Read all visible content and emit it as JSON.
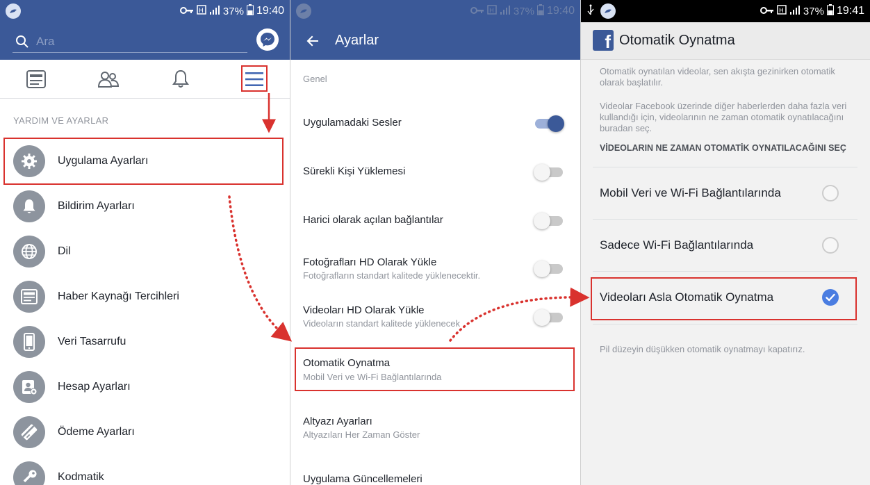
{
  "status_left": {
    "signal": "37%",
    "time": "19:40"
  },
  "status_mid": {
    "signal": "37%",
    "time": "19:40"
  },
  "status_right": {
    "signal": "37%",
    "time": "19:41"
  },
  "panel1": {
    "search": {
      "placeholder": "Ara"
    },
    "section_label": "YARDIM VE AYARLAR",
    "items": [
      {
        "label": "Uygulama Ayarları",
        "icon": "gear-icon"
      },
      {
        "label": "Bildirim Ayarları",
        "icon": "bell-icon"
      },
      {
        "label": "Dil",
        "icon": "globe-icon"
      },
      {
        "label": "Haber Kaynağı Tercihleri",
        "icon": "newsfeed-icon"
      },
      {
        "label": "Veri Tasarrufu",
        "icon": "phone-icon"
      },
      {
        "label": "Hesap Ayarları",
        "icon": "account-settings-icon"
      },
      {
        "label": "Ödeme Ayarları",
        "icon": "payment-icon"
      },
      {
        "label": "Kodmatik",
        "icon": "key-icon"
      }
    ]
  },
  "panel2": {
    "title": "Ayarlar",
    "section": "Genel",
    "settings": [
      {
        "title": "Uygulamadaki Sesler",
        "sub": "",
        "toggle": true
      },
      {
        "title": "Sürekli Kişi Yüklemesi",
        "sub": "",
        "toggle": false
      },
      {
        "title": "Harici olarak açılan bağlantılar",
        "sub": "",
        "toggle": false
      },
      {
        "title": "Fotoğrafları HD Olarak Yükle",
        "sub": "Fotoğrafların standart kalitede yüklenecektir.",
        "toggle": false
      },
      {
        "title": "Videoları HD Olarak Yükle",
        "sub": "Videoların standart kalitede yüklenecek",
        "toggle": false
      },
      {
        "title": "Otomatik Oynatma",
        "sub": "Mobil Veri ve Wi-Fi Bağlantılarında"
      },
      {
        "title": "Altyazı Ayarları",
        "sub": "Altyazıları Her Zaman Göster"
      },
      {
        "title": "Uygulama Güncellemeleri",
        "sub": ""
      }
    ]
  },
  "panel3": {
    "title": "Otomatik Oynatma",
    "desc1": "Otomatik oynatılan videolar, sen akışta gezinirken otomatik olarak başlatılır.",
    "desc2": "Videolar Facebook üzerinde diğer haberlerden daha fazla veri kullandığı için, videolarının ne zaman otomatik oynatılacağını buradan seç.",
    "question": "VİDEOLARIN NE ZAMAN OTOMATİK OYNATILACAĞINI SEÇ",
    "options": [
      {
        "label": "Mobil Veri ve Wi-Fi Bağlantılarında",
        "selected": false
      },
      {
        "label": "Sadece Wi-Fi Bağlantılarında",
        "selected": false
      },
      {
        "label": "Videoları Asla Otomatik Oynatma",
        "selected": true
      }
    ],
    "note": "Pil düzeyin düşükken otomatik oynatmayı kapatırız."
  },
  "colors": {
    "brand": "#3b5998",
    "highlight": "#d9322e",
    "check": "#4a7de1"
  }
}
